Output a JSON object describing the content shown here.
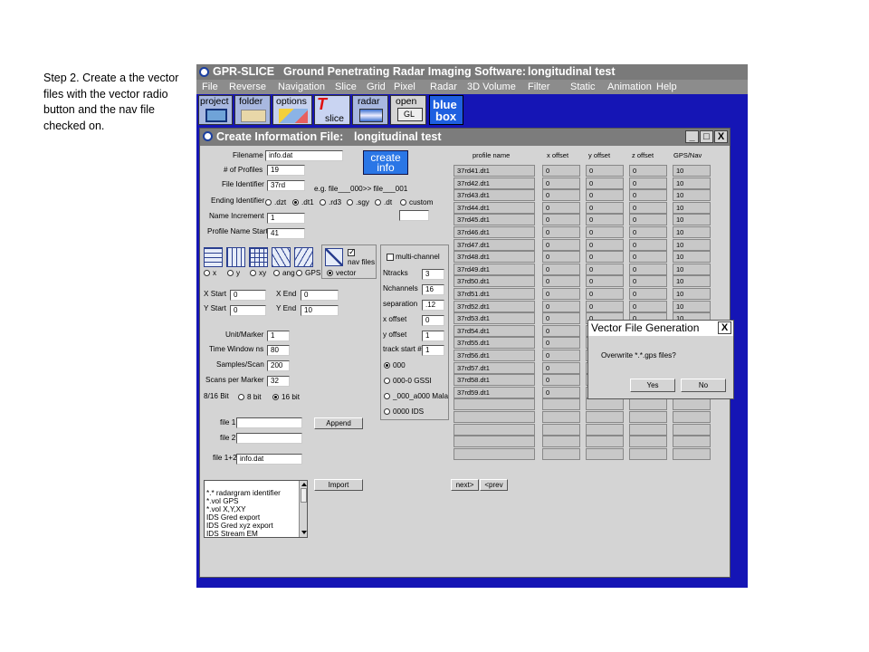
{
  "caption": "Step 2.  Create a the vector files with the vector radio button and the nav file checked on.",
  "app": {
    "title_prefix": "GPR-SLICE",
    "title_main": "Ground Penetrating Radar Imaging Software:",
    "title_project": "longitudinal test",
    "menu": [
      "File",
      "Reverse",
      "Navigation",
      "Slice",
      "Grid",
      "Pixel",
      "Radar",
      "3D Volume",
      "Filter",
      "Static",
      "Animation",
      "Help"
    ],
    "toolbar": {
      "project": "project",
      "folder": "folder",
      "options": "options",
      "slice": "slice",
      "slice_t": "T",
      "radar": "radar",
      "open": "open",
      "gl": "GL",
      "bluebox_1": "blue",
      "bluebox_2": "box"
    }
  },
  "child": {
    "title": "Create Information File:",
    "project": "longitudinal test",
    "win_min": "_",
    "win_max": "□",
    "win_close": "X",
    "create_info_1": "create",
    "create_info_2": "info",
    "fields": {
      "filename_label": "Filename",
      "filename_value": "info.dat",
      "num_profiles_label": "# of Profiles",
      "num_profiles_value": "19",
      "file_identifier_label": "File Identifier",
      "file_identifier_value": "37rd",
      "file_identifier_hint": "e.g. file___000>> file___001",
      "ending_identifier_label": "Ending Identifier",
      "ending_options": [
        ".dzt",
        ".dt1",
        ".rd3",
        ".sgy",
        ".dt",
        "custom"
      ],
      "name_increment_label": "Name Increment",
      "name_increment_value": "1",
      "profile_name_start_label": "Profile Name Start",
      "profile_name_start_value": "41"
    },
    "direction_options": [
      "x",
      "y",
      "xy",
      "ang",
      "GPS",
      "vector"
    ],
    "nav_files_label": "nav files",
    "coords": {
      "x_start_label": "X Start",
      "x_start_value": "0",
      "x_end_label": "X End",
      "x_end_value": "0",
      "y_start_label": "Y Start",
      "y_start_value": "0",
      "y_end_label": "Y End",
      "y_end_value": "10"
    },
    "params": {
      "unit_marker_label": "Unit/Marker",
      "unit_marker_value": "1",
      "time_window_label": "Time Window ns",
      "time_window_value": "80",
      "samples_scan_label": "Samples/Scan",
      "samples_scan_value": "200",
      "scans_marker_label": "Scans per Marker",
      "scans_marker_value": "32",
      "bit_label": "8/16 Bit",
      "bit_8": "8 bit",
      "bit_16": "16 bit"
    },
    "files": {
      "file1_label": "file 1",
      "file1_value": "",
      "file2_label": "file 2",
      "file2_value": "",
      "file12_label": "file 1+2",
      "file12_value": "info.dat",
      "append": "Append",
      "import": "Import"
    },
    "multichannel": {
      "label": "multi-channel",
      "ntracks_label": "Ntracks",
      "ntracks_value": "3",
      "nchannels_label": "Nchannels",
      "nchannels_value": "16",
      "separation_label": "separation",
      "separation_value": ".12",
      "xoffset_label": "x offset",
      "xoffset_value": "0",
      "yoffset_label": "y offset",
      "yoffset_value": "1",
      "trackstart_label": "track start #",
      "trackstart_value": "1",
      "options": [
        "000",
        "000-0 GSSI",
        "_000_a000 Mala",
        "0000 IDS"
      ]
    },
    "import_list": [
      "*.* radargram identifier",
      "*.vol GPS",
      "*.vol X,Y,XY",
      "IDS Gred export",
      "IDS Gred xyz export",
      "IDS Stream EM"
    ],
    "table": {
      "headers": [
        "profile name",
        "x offset",
        "y offset",
        "z offset",
        "GPS/Nav"
      ],
      "rows": [
        [
          "37rd41.dt1",
          "0",
          "0",
          "0",
          "10"
        ],
        [
          "37rd42.dt1",
          "0",
          "0",
          "0",
          "10"
        ],
        [
          "37rd43.dt1",
          "0",
          "0",
          "0",
          "10"
        ],
        [
          "37rd44.dt1",
          "0",
          "0",
          "0",
          "10"
        ],
        [
          "37rd45.dt1",
          "0",
          "0",
          "0",
          "10"
        ],
        [
          "37rd46.dt1",
          "0",
          "0",
          "0",
          "10"
        ],
        [
          "37rd47.dt1",
          "0",
          "0",
          "0",
          "10"
        ],
        [
          "37rd48.dt1",
          "0",
          "0",
          "0",
          "10"
        ],
        [
          "37rd49.dt1",
          "0",
          "0",
          "0",
          "10"
        ],
        [
          "37rd50.dt1",
          "0",
          "0",
          "0",
          "10"
        ],
        [
          "37rd51.dt1",
          "0",
          "0",
          "0",
          "10"
        ],
        [
          "37rd52.dt1",
          "0",
          "0",
          "0",
          "10"
        ],
        [
          "37rd53.dt1",
          "0",
          "0",
          "0",
          "10"
        ],
        [
          "37rd54.dt1",
          "0",
          "",
          "",
          "10"
        ],
        [
          "37rd55.dt1",
          "0",
          "",
          "",
          "10"
        ],
        [
          "37rd56.dt1",
          "0",
          "",
          "",
          "10"
        ],
        [
          "37rd57.dt1",
          "0",
          "",
          "",
          "10"
        ],
        [
          "37rd58.dt1",
          "0",
          "0",
          "0",
          "10"
        ],
        [
          "37rd59.dt1",
          "0",
          "0",
          "0",
          "10"
        ]
      ],
      "next": "next>",
      "prev": "<prev"
    }
  },
  "dialog": {
    "title": "Vector File Generation",
    "close": "X",
    "message": "Overwrite *.*.gps files?",
    "yes": "Yes",
    "no": "No"
  },
  "colors": {
    "app_bg": "#1515b5",
    "panel": "#d4d4d4",
    "accent": "#2a76e6"
  }
}
